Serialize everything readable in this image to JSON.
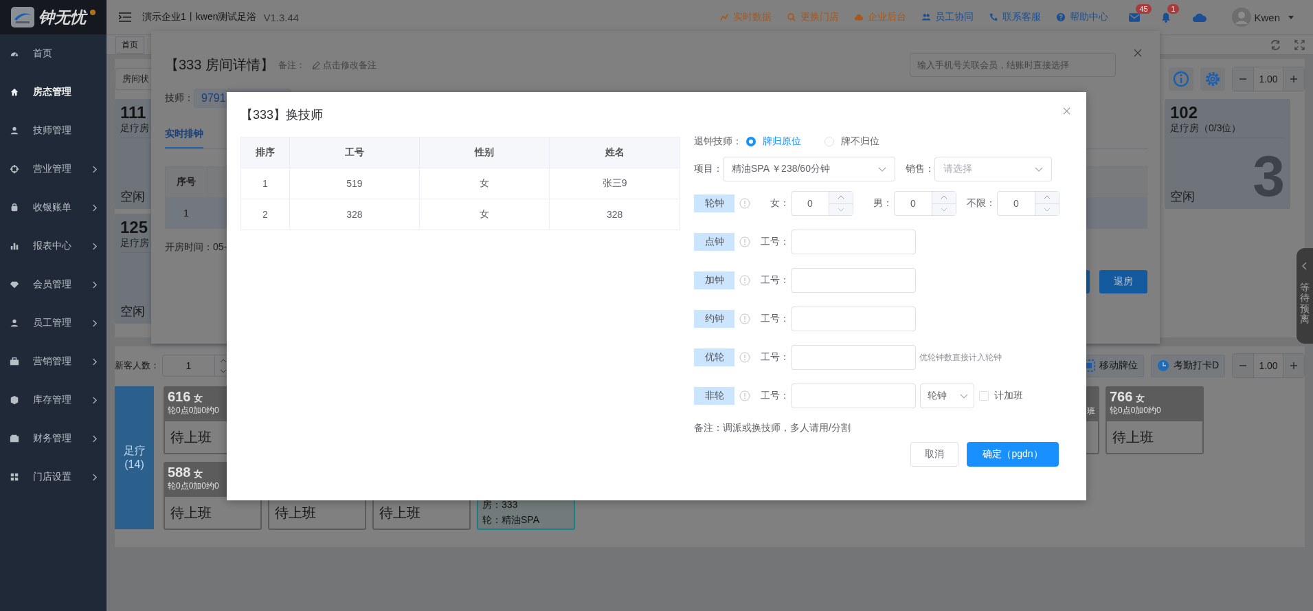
{
  "sidebar": {
    "logo": "钟无忧",
    "items": [
      {
        "label": "首页",
        "selected": false,
        "expandable": false
      },
      {
        "label": "房态管理",
        "selected": true,
        "expandable": false
      },
      {
        "label": "技师管理",
        "selected": false,
        "expandable": false
      },
      {
        "label": "营业管理",
        "selected": false,
        "expandable": true
      },
      {
        "label": "收银账单",
        "selected": false,
        "expandable": true
      },
      {
        "label": "报表中心",
        "selected": false,
        "expandable": true
      },
      {
        "label": "会员管理",
        "selected": false,
        "expandable": true
      },
      {
        "label": "员工管理",
        "selected": false,
        "expandable": true
      },
      {
        "label": "营销管理",
        "selected": false,
        "expandable": true
      },
      {
        "label": "库存管理",
        "selected": false,
        "expandable": true
      },
      {
        "label": "财务管理",
        "selected": false,
        "expandable": true
      },
      {
        "label": "门店设置",
        "selected": false,
        "expandable": true
      }
    ]
  },
  "header": {
    "title": "演示企业1丨kwen测试足浴",
    "version": "V1.3.44",
    "links": [
      {
        "label": "实时数据",
        "color": "#a8581a"
      },
      {
        "label": "更换门店",
        "color": "#a8581a"
      },
      {
        "label": "企业后台",
        "color": "#a8581a"
      },
      {
        "label": "员工协同",
        "color": "#1b4f94"
      },
      {
        "label": "联系客服",
        "color": "#1b4f94"
      },
      {
        "label": "帮助中心",
        "color": "#1b4f94"
      }
    ],
    "mail_badge": "45",
    "bell_badge": "1",
    "user": "Kwen"
  },
  "tabs": [
    {
      "label": "首页"
    }
  ],
  "room_panel": {
    "filter": "房间状",
    "zoom": "1.00",
    "rooms": [
      {
        "number": "111",
        "type": "足疗房",
        "status": "空闲"
      },
      {
        "number": "125",
        "type": "足疗房",
        "status": "空闲"
      }
    ],
    "side_room": {
      "number": "102",
      "type": "足疗房（0/3位）",
      "count": "3",
      "status": "空闲"
    }
  },
  "floating_tab": {
    "label": "等待预离"
  },
  "tech_panel": {
    "new_guests_label": "新客人数：",
    "new_guests": "1",
    "actions": [
      {
        "label": "移动牌位"
      },
      {
        "label": "考勤打卡D"
      }
    ],
    "zoom": "1.00",
    "category": {
      "name": "足疗",
      "count": "(14)"
    },
    "rows": [
      [
        {
          "kind": "tech",
          "number": "616",
          "gender": "女",
          "counts": "轮0点0加0约0",
          "status": "待上班"
        },
        {
          "kind": "partial",
          "counts": "班"
        },
        {
          "kind": "tech",
          "number": "766",
          "gender": "女",
          "counts": "轮0点0加0约0",
          "status": "待上班"
        }
      ],
      [
        {
          "kind": "tech",
          "number": "588",
          "gender": "女",
          "counts": "轮0点0加0约0",
          "status": "待上班"
        },
        {
          "kind": "status",
          "status": "待上班"
        },
        {
          "kind": "status",
          "status": "待上班"
        },
        {
          "kind": "room",
          "room": "房：333",
          "item": "轮：精油SPA"
        }
      ]
    ]
  },
  "room_dialog": {
    "title": "【333 房间详情】",
    "note_label": "备注：",
    "note_link": "点击修改备注",
    "member_placeholder": "输入手机号关联会员，结账时直接选择",
    "tech_label": "技师：",
    "tech_tag": "9791",
    "tabs": [
      {
        "label": "实时排钟",
        "selected": true
      }
    ],
    "table_header": "序号",
    "table_row": "1",
    "open_time": "开房时间：05-",
    "checkout": "退房"
  },
  "swap_dialog": {
    "title": "【333】换技师",
    "columns": [
      "排序",
      "工号",
      "性别",
      "姓名"
    ],
    "rows": [
      [
        "1",
        "519",
        "女",
        "张三9"
      ],
      [
        "2",
        "328",
        "女",
        "328"
      ]
    ],
    "return_label": "退钟技师：",
    "return_options": [
      {
        "label": "牌归原位",
        "selected": true
      },
      {
        "label": "牌不归位",
        "selected": false
      }
    ],
    "item_label": "项目：",
    "item_value": "精油SPA ￥238/60分钟",
    "sales_label": "销售：",
    "sales_placeholder": "请选择",
    "rotation": {
      "tag": "轮钟",
      "fields": [
        {
          "label": "女：",
          "value": "0"
        },
        {
          "label": "男：",
          "value": "0"
        },
        {
          "label": "不限：",
          "value": "0"
        }
      ]
    },
    "assign_rows": [
      {
        "kind": "plain",
        "tag": "点钟",
        "label": "工号："
      },
      {
        "kind": "plain",
        "tag": "加钟",
        "label": "工号："
      },
      {
        "kind": "plain",
        "tag": "约钟",
        "label": "工号："
      },
      {
        "kind": "hint",
        "tag": "优轮",
        "label": "工号：",
        "hint": "优轮钟数直接计入轮钟"
      },
      {
        "kind": "extra",
        "tag": "非轮",
        "label": "工号：",
        "select": "轮钟",
        "checkbox": {
          "label": "计加班",
          "checked": false
        }
      }
    ],
    "note": "备注：调派或换技师，多人请用/分割",
    "buttons": [
      {
        "label": "取消",
        "kind": "secondary"
      },
      {
        "label": "确定（pgdn）",
        "kind": "primary"
      }
    ]
  }
}
